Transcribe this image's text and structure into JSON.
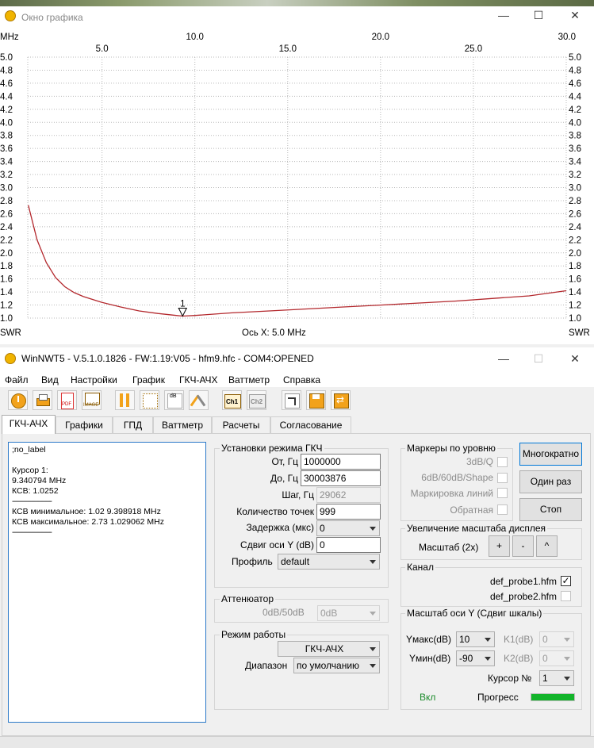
{
  "graph_window": {
    "title": "Окно графика",
    "x_unit": "MHz",
    "y_unit": "SWR",
    "axis_caption": "Ось X: 5.0 MHz"
  },
  "chart_data": {
    "type": "line",
    "x_ticks_top": [
      10.0,
      20.0,
      30.0
    ],
    "x_tick_labels_top": [
      "10.0",
      "20.0",
      "30.0"
    ],
    "x_ticks_bottom": [
      5.0,
      15.0,
      25.0
    ],
    "x_tick_labels_bottom": [
      "5.0",
      "15.0",
      "25.0"
    ],
    "y_ticks": [
      "5.0",
      "4.8",
      "4.6",
      "4.4",
      "4.2",
      "4.0",
      "3.8",
      "3.6",
      "3.4",
      "3.2",
      "3.0",
      "2.8",
      "2.6",
      "2.4",
      "2.2",
      "2.0",
      "1.8",
      "1.6",
      "1.4",
      "1.2",
      "1.0"
    ],
    "xlim": [
      1.0,
      30.0
    ],
    "ylim": [
      1.0,
      5.0
    ],
    "grid": true,
    "line_color": "#b3282d",
    "series": [
      {
        "x": [
          1.03,
          1.5,
          2.0,
          2.5,
          3.0,
          3.5,
          4.0,
          5.0,
          6.0,
          7.0,
          8.0,
          9.0,
          9.34,
          10.0,
          12.0,
          14.0,
          16.0,
          18.0,
          20.0,
          22.0,
          24.0,
          26.0,
          28.0,
          30.0
        ],
        "y": [
          2.73,
          2.2,
          1.85,
          1.62,
          1.48,
          1.39,
          1.33,
          1.24,
          1.17,
          1.11,
          1.07,
          1.04,
          1.03,
          1.04,
          1.08,
          1.11,
          1.14,
          1.17,
          1.2,
          1.23,
          1.26,
          1.3,
          1.34,
          1.42
        ]
      }
    ],
    "marker": {
      "label": "1",
      "x": 9.34,
      "y": 1.03
    }
  },
  "main_window": {
    "title": "WinNWT5 - V.5.1.0.1826 - FW:1.19:V05 - hfm9.hfc - COM4:OPENED"
  },
  "menu": [
    "Файл",
    "Вид",
    "Настройки",
    "График",
    "ГКЧ-АЧХ",
    "Ваттметр",
    "Справка"
  ],
  "toolbar": [
    "power-icon",
    "print-icon",
    "pdf-icon",
    "image-icon",
    "tools-icon",
    "grid-icon",
    "db-chart-icon",
    "antenna-icon",
    "ch1-icon",
    "ch2-icon",
    "sweep-icon",
    "save-icon",
    "exchange-icon"
  ],
  "toolbar_text": {
    "pdf": "PDF",
    "image": "IMAGE",
    "ch1": "Ch1",
    "ch2": "Ch2",
    "db": "dB"
  },
  "tabs": [
    "ГКЧ-АЧХ",
    "Графики",
    "ГПД",
    "Ваттметр",
    "Расчеты",
    "Согласование"
  ],
  "info_text": [
    ";no_label",
    "",
    "Курсор 1:",
    "9.340794 MHz",
    "КСВ: 1.0252",
    "--------------------",
    "КСВ минимальное: 1.02  9.398918 MHz",
    "КСВ максимальное: 2.73  1.029062 MHz",
    "--------------------"
  ],
  "sweep": {
    "group_title": "Установки режима ГКЧ",
    "from_label": "От, Гц",
    "from_value": "1000000",
    "to_label": "До, Гц",
    "to_value": "30003876",
    "step_label": "Шаг, Гц",
    "step_value": "29062",
    "points_label": "Количество точек",
    "points_value": "999",
    "delay_label": "Задержка (мкс)",
    "delay_value": "0",
    "yshift_label": "Сдвиг оси Y (dB)",
    "yshift_value": "0",
    "profile_label": "Профиль",
    "profile_value": "default"
  },
  "attenuator": {
    "group_title": "Аттенюатор",
    "label": "0dB/50dB",
    "value": "0dB"
  },
  "mode": {
    "group_title": "Режим работы",
    "value": "ГКЧ-АЧХ",
    "range_label": "Диапазон",
    "range_value": "по умолчанию"
  },
  "markers": {
    "group_title": "Маркеры по уровню",
    "items": [
      "3dB/Q",
      "6dB/60dB/Shape",
      "Маркировка линий",
      "Обратная"
    ]
  },
  "buttons": {
    "multi": "Многократно",
    "once": "Один раз",
    "stop": "Стоп"
  },
  "zoom": {
    "group_title": "Увеличение масштаба дисплея",
    "label": "Масштаб (2x)",
    "plus": "+",
    "minus": "-",
    "caret": "^"
  },
  "channel": {
    "group_title": "Канал",
    "probe1": "def_probe1.hfm",
    "probe1_checked": "✓",
    "probe2": "def_probe2.hfm"
  },
  "yscale": {
    "group_title": "Масштаб оси Y (Сдвиг шкалы)",
    "ymax_label": "Yмакс(dB)",
    "ymax_value": "10",
    "ymin_label": "Yмин(dB)",
    "ymin_value": "-90",
    "k1_label": "K1(dB)",
    "k1_value": "0",
    "k2_label": "K2(dB)",
    "k2_value": "0",
    "cursor_label": "Курсор №",
    "cursor_value": "1"
  },
  "status": {
    "on_label": "Вкл",
    "progress_label": "Прогресс",
    "progress_color": "#13b42a"
  }
}
